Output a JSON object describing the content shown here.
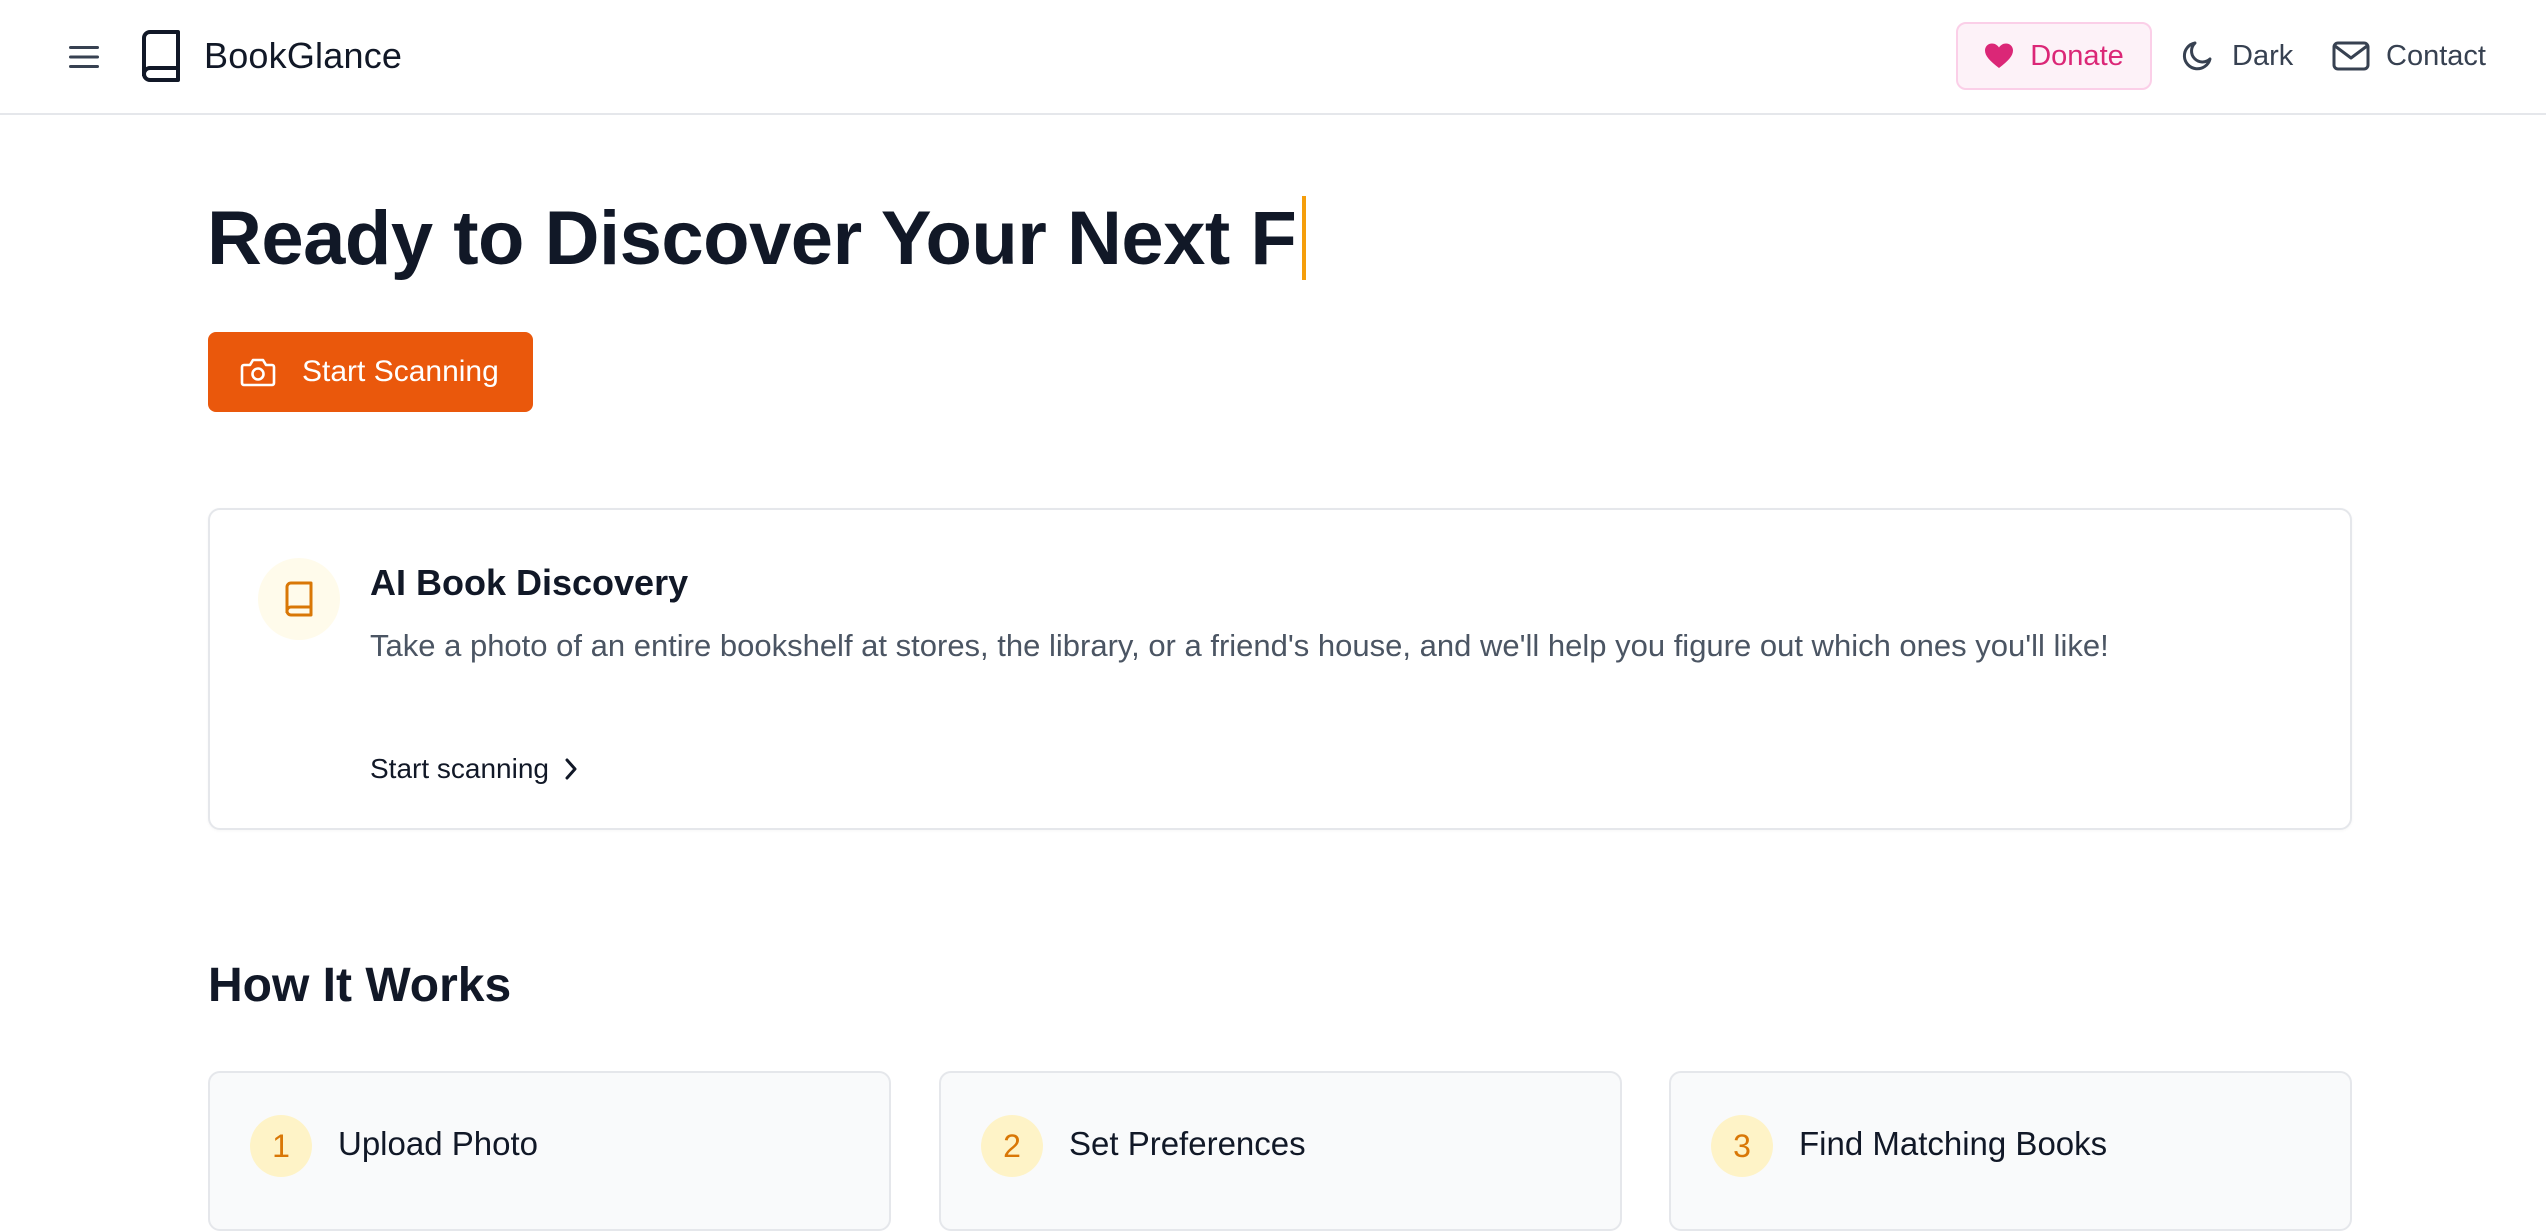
{
  "header": {
    "brand_name": "BookGlance",
    "menu_icon": "hamburger-menu-icon",
    "logo_icon": "book-icon",
    "donate_label": "Donate",
    "donate_icon": "heart-icon",
    "dark_label": "Dark",
    "dark_icon": "moon-icon",
    "contact_label": "Contact",
    "contact_icon": "mail-icon"
  },
  "hero": {
    "title": "Ready to Discover Your Next F",
    "cta_label": "Start Scanning",
    "cta_icon": "camera-icon"
  },
  "feature": {
    "icon": "book-icon",
    "title": "AI Book Discovery",
    "description": "Take a photo of an entire bookshelf at stores, the library, or a friend's house, and we'll help you figure out which ones you'll like!",
    "link_label": "Start scanning",
    "link_icon": "chevron-right-icon"
  },
  "how_it_works": {
    "title": "How It Works",
    "steps": [
      {
        "number": "1",
        "title": "Upload Photo"
      },
      {
        "number": "2",
        "title": "Set Preferences"
      },
      {
        "number": "3",
        "title": "Find Matching Books"
      }
    ]
  },
  "colors": {
    "accent": "#ea580c",
    "donate": "#db2777",
    "step_badge_bg": "#fef3c7",
    "step_badge_text": "#d97706",
    "caret": "#f59e0b"
  }
}
